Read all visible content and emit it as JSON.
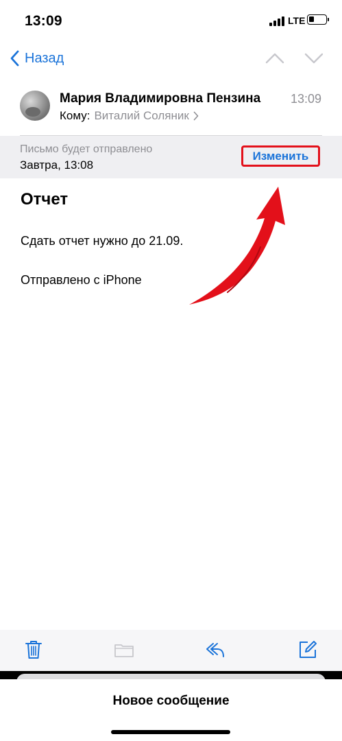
{
  "status_bar": {
    "time": "13:09",
    "network": "LTE",
    "icons": [
      "signal-icon",
      "battery-icon"
    ]
  },
  "nav": {
    "back_label": "Назад",
    "icons": [
      "chevron-left-icon",
      "chevron-up-icon",
      "chevron-down-icon"
    ],
    "accent_color": "#1a73d9"
  },
  "message": {
    "sender": "Мария Владимировна Пензина",
    "time": "13:09",
    "to_label": "Кому:",
    "recipient": "Виталий Соляник",
    "subject": "Отчет",
    "body": "Сдать отчет нужно до 21.09.",
    "signature": "Отправлено с iPhone"
  },
  "schedule": {
    "title": "Письмо будет отправлено",
    "date": "Завтра, 13:08",
    "change_label": "Изменить",
    "highlight_color": "#e3101a"
  },
  "toolbar": {
    "icons": [
      "trash-icon",
      "folder-icon",
      "reply-icon",
      "compose-icon"
    ]
  },
  "sheet": {
    "title": "Новое сообщение"
  }
}
